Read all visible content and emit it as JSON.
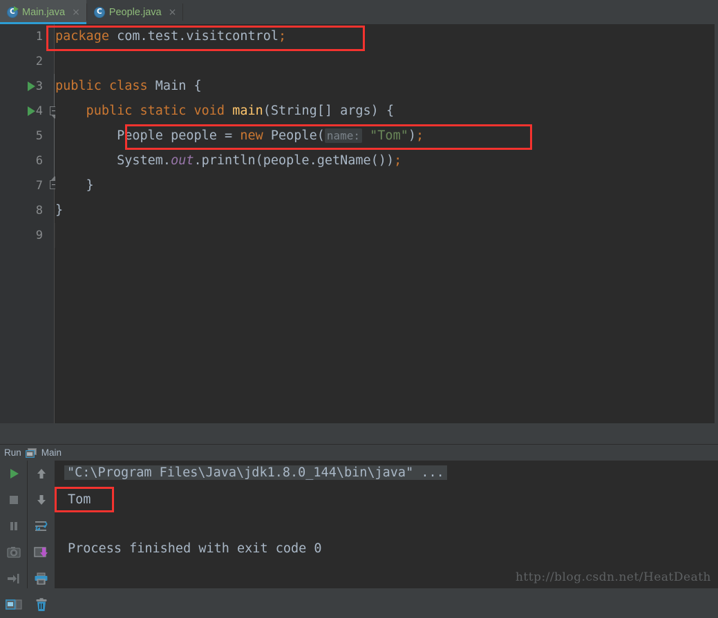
{
  "tabs": [
    {
      "label": "Main.java",
      "icon": "java-class-runnable-icon",
      "active": true,
      "close": "×"
    },
    {
      "label": "People.java",
      "icon": "java-class-icon",
      "active": false,
      "close": "×"
    }
  ],
  "editor": {
    "lines": [
      {
        "num": "1",
        "segments": [
          {
            "t": "package ",
            "c": "k"
          },
          {
            "t": "com.test.visitcontrol",
            "c": "id"
          },
          {
            "t": ";",
            "c": "k"
          }
        ]
      },
      {
        "num": "2",
        "segments": []
      },
      {
        "num": "3",
        "segments": [
          {
            "t": "public class ",
            "c": "k"
          },
          {
            "t": "Main",
            "c": "id"
          },
          {
            "t": " {",
            "c": "id"
          }
        ]
      },
      {
        "num": "4",
        "segments": [
          {
            "t": "    public static void ",
            "c": "k"
          },
          {
            "t": "main",
            "c": "mth"
          },
          {
            "t": "(String[] args) {",
            "c": "id"
          }
        ]
      },
      {
        "num": "5",
        "segments": [
          {
            "t": "        People people = ",
            "c": "id"
          },
          {
            "t": "new ",
            "c": "k"
          },
          {
            "t": "People(",
            "c": "id"
          },
          {
            "t": "name:",
            "c": "hint"
          },
          {
            "t": " ",
            "c": "id"
          },
          {
            "t": "\"Tom\"",
            "c": "st"
          },
          {
            "t": ")",
            "c": "id"
          },
          {
            "t": ";",
            "c": "k"
          }
        ]
      },
      {
        "num": "6",
        "segments": [
          {
            "t": "        System.",
            "c": "id"
          },
          {
            "t": "out",
            "c": "fld"
          },
          {
            "t": ".println(people.getName())",
            "c": "id"
          },
          {
            "t": ";",
            "c": "k"
          }
        ]
      },
      {
        "num": "7",
        "segments": [
          {
            "t": "    }",
            "c": "id"
          }
        ]
      },
      {
        "num": "8",
        "segments": [
          {
            "t": "}",
            "c": "id"
          }
        ]
      },
      {
        "num": "9",
        "segments": []
      }
    ],
    "run_gutter_lines": [
      "3",
      "4"
    ],
    "caret_line": "9"
  },
  "run_panel": {
    "title": "Run",
    "config_name": "Main",
    "left_toolbar": [
      {
        "name": "rerun-button",
        "icon": "play-icon"
      },
      {
        "name": "stop-button",
        "icon": "stop-icon"
      },
      {
        "name": "pause-button",
        "icon": "pause-icon"
      },
      {
        "name": "thread-dump-button",
        "icon": "camera-icon"
      },
      {
        "name": "close-session-button",
        "icon": "exit-icon"
      },
      {
        "name": "layout-settings-button",
        "icon": "layout-icon"
      }
    ],
    "right_toolbar": [
      {
        "name": "prev-occurrence-button",
        "icon": "arrow-up-icon"
      },
      {
        "name": "next-occurrence-button",
        "icon": "arrow-down-icon"
      },
      {
        "name": "soft-wrap-button",
        "icon": "soft-wrap-icon"
      },
      {
        "name": "scroll-to-end-button",
        "icon": "export-icon"
      },
      {
        "name": "print-button",
        "icon": "printer-icon"
      },
      {
        "name": "clear-all-button",
        "icon": "trash-icon"
      }
    ],
    "console": {
      "command_line": "\"C:\\Program Files\\Java\\jdk1.8.0_144\\bin\\java\" ...",
      "output": "Tom",
      "exit_message": "Process finished with exit code 0"
    }
  },
  "watermark": "http://blog.csdn.net/HeatDeath",
  "colors": {
    "editor_bg": "#2b2b2b",
    "gutter_bg": "#313335",
    "chrome_bg": "#3c3f41",
    "keyword": "#cc7832",
    "string": "#6a8759",
    "method": "#ffc66d",
    "field": "#9876aa",
    "identifier": "#a9b7c6",
    "tab_active_underline": "#2d9dd4",
    "tab_label": "#8fbc7a",
    "annotation_red": "#f4332f",
    "run_green": "#499c54"
  }
}
